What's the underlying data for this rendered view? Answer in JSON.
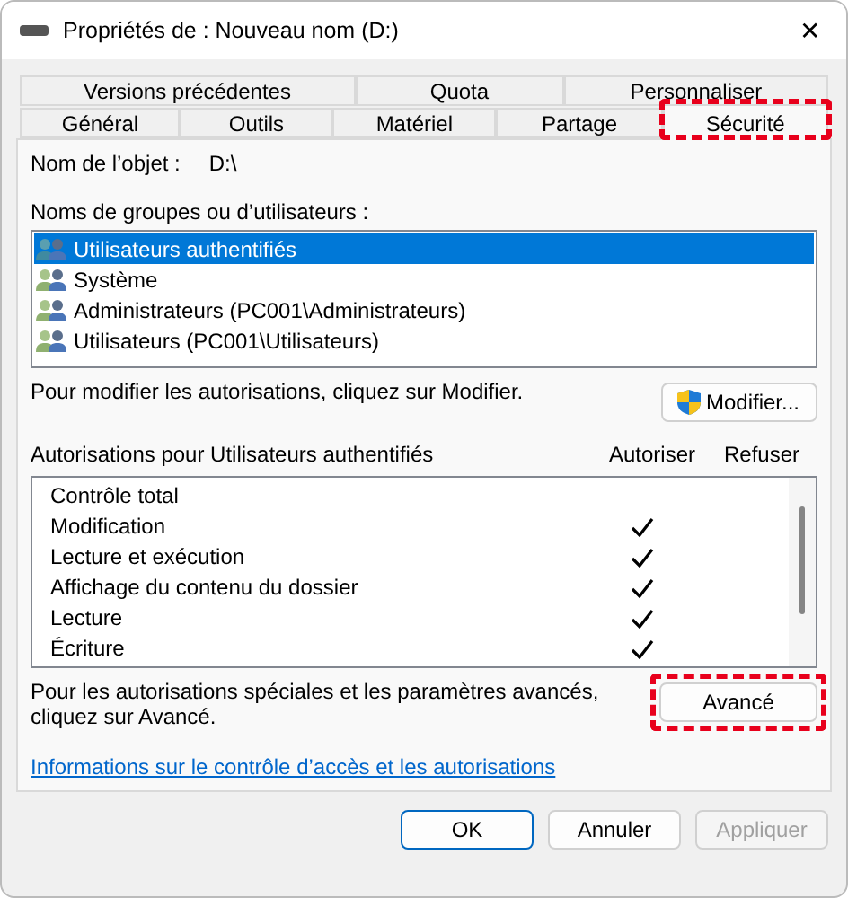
{
  "window": {
    "title": "Propriétés de : Nouveau nom (D:)",
    "close": "✕"
  },
  "tab_rows": [
    [
      {
        "label": "Versions précédentes",
        "selected": false,
        "highlighted": false
      },
      {
        "label": "Quota",
        "selected": false,
        "highlighted": false
      },
      {
        "label": "Personnaliser",
        "selected": false,
        "highlighted": false
      }
    ],
    [
      {
        "label": "Général",
        "selected": false,
        "highlighted": false
      },
      {
        "label": "Outils",
        "selected": false,
        "highlighted": false
      },
      {
        "label": "Matériel",
        "selected": false,
        "highlighted": false
      },
      {
        "label": "Partage",
        "selected": false,
        "highlighted": false
      },
      {
        "label": "Sécurité",
        "selected": true,
        "highlighted": true
      }
    ]
  ],
  "object": {
    "label": "Nom de l’objet :",
    "value": "D:\\"
  },
  "groups": {
    "label": "Noms de groupes ou d’utilisateurs :",
    "items": [
      {
        "name": "Utilisateurs authentifiés",
        "selected": true
      },
      {
        "name": "Système",
        "selected": false
      },
      {
        "name": "Administrateurs (PC001\\Administrateurs)",
        "selected": false
      },
      {
        "name": "Utilisateurs (PC001\\Utilisateurs)",
        "selected": false
      }
    ]
  },
  "modify": {
    "text": "Pour modifier les autorisations, cliquez sur Modifier.",
    "button": "Modifier..."
  },
  "permissions": {
    "title": "Autorisations pour Utilisateurs authentifiés",
    "columns": [
      "Autoriser",
      "Refuser"
    ],
    "rows": [
      {
        "name": "Contrôle total",
        "allow": false,
        "deny": false
      },
      {
        "name": "Modification",
        "allow": true,
        "deny": false
      },
      {
        "name": "Lecture et exécution",
        "allow": true,
        "deny": false
      },
      {
        "name": "Affichage du contenu du dossier",
        "allow": true,
        "deny": false
      },
      {
        "name": "Lecture",
        "allow": true,
        "deny": false
      },
      {
        "name": "Écriture",
        "allow": true,
        "deny": false
      }
    ]
  },
  "advanced": {
    "text": "Pour les autorisations spéciales et les paramètres avancés, cliquez sur Avancé.",
    "button": "Avancé",
    "highlighted": true
  },
  "link": "Informations sur le contrôle d’accès et les autorisations",
  "buttons": [
    {
      "label": "OK",
      "kind": "default",
      "disabled": false
    },
    {
      "label": "Annuler",
      "kind": "normal",
      "disabled": false
    },
    {
      "label": "Appliquer",
      "kind": "normal",
      "disabled": true
    }
  ]
}
